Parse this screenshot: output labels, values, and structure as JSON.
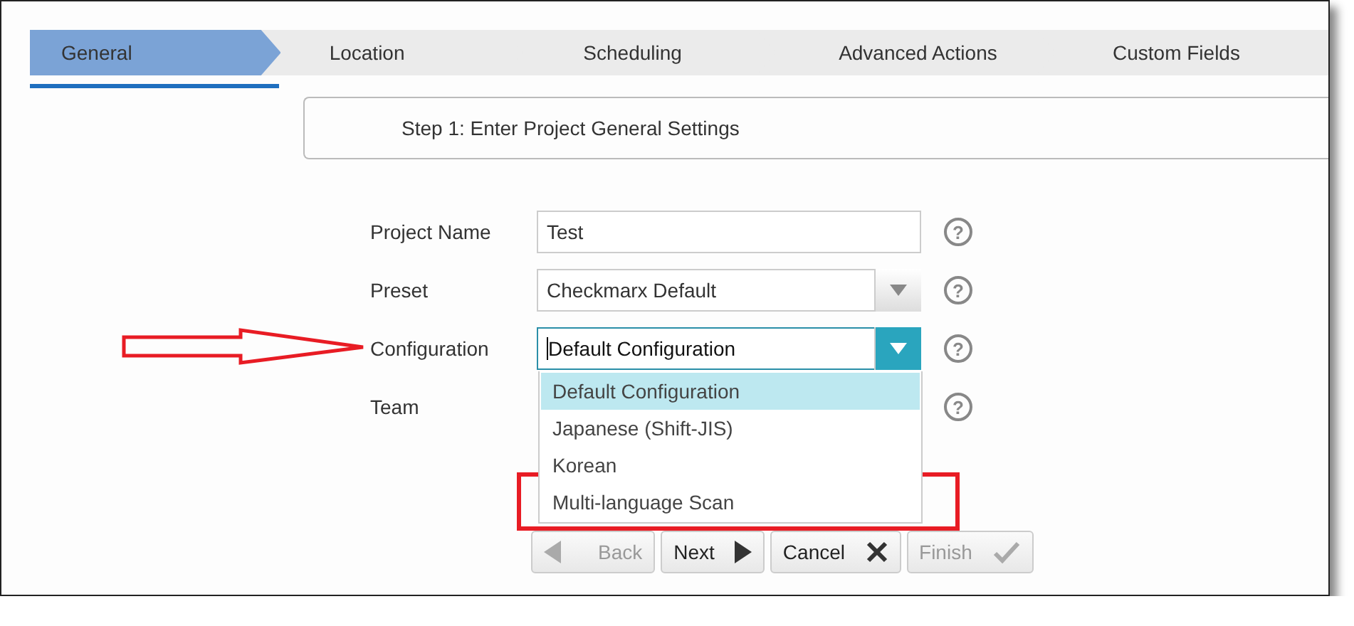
{
  "tabs": [
    {
      "label": "General",
      "selected": true
    },
    {
      "label": "Location",
      "selected": false
    },
    {
      "label": "Scheduling",
      "selected": false
    },
    {
      "label": "Advanced Actions",
      "selected": false
    },
    {
      "label": "Custom Fields",
      "selected": false
    }
  ],
  "step_title": "Step 1: Enter Project General Settings",
  "fields": [
    {
      "kind": "text",
      "label": "Project Name",
      "value": "Test",
      "help": "?"
    },
    {
      "kind": "select",
      "label": "Preset",
      "value": "Checkmarx Default",
      "help": "?"
    },
    {
      "kind": "select",
      "label": "Configuration",
      "value": "Default Configuration",
      "expanded": true,
      "help": "?",
      "options": [
        {
          "label": "Default Configuration",
          "selected": true
        },
        {
          "label": "Japanese (Shift-JIS)",
          "selected": false
        },
        {
          "label": "Korean",
          "selected": false
        },
        {
          "label": "Multi-language Scan",
          "selected": false
        }
      ]
    },
    {
      "kind": "select",
      "label": "Team",
      "help": "?"
    }
  ],
  "buttons": [
    {
      "kind": "back",
      "label": "Back",
      "disabled": true
    },
    {
      "kind": "next",
      "label": "Next",
      "disabled": false
    },
    {
      "kind": "cancel",
      "label": "Cancel",
      "disabled": false
    },
    {
      "kind": "finish",
      "label": "Finish",
      "disabled": true
    }
  ]
}
